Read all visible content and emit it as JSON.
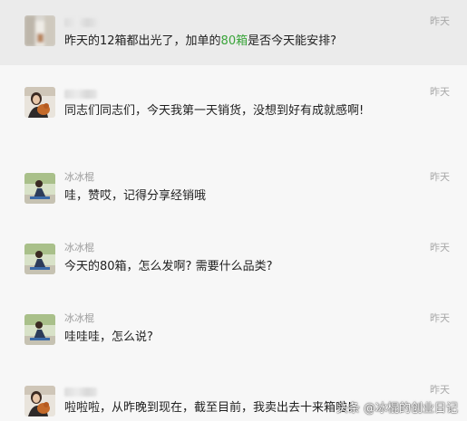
{
  "comments": [
    {
      "name": "",
      "name_blurred": true,
      "time": "昨天",
      "message_before": "昨天的12箱都出光了，加单的",
      "message_highlight": "80箱",
      "message_after": "是否今天能安排?",
      "avatar": "blurred-avatar-icon"
    },
    {
      "name": "",
      "name_blurred": true,
      "time": "昨天",
      "message": "同志们同志们，今天我第一天销货，没想到好有成就感啊!",
      "avatar": "woman-with-dog-avatar-icon"
    },
    {
      "name": "冰冰棍",
      "time": "昨天",
      "message": "哇，赞哎，记得分享经销哦",
      "avatar": "person-outdoors-avatar-icon"
    },
    {
      "name": "冰冰棍",
      "time": "昨天",
      "message": "今天的80箱，怎么发啊? 需要什么品类?",
      "avatar": "person-outdoors-avatar-icon"
    },
    {
      "name": "冰冰棍",
      "time": "昨天",
      "message": "哇哇哇，怎么说?",
      "avatar": "person-outdoors-avatar-icon"
    },
    {
      "name": "",
      "name_blurred": true,
      "time": "昨天",
      "message": "啦啦啦，从昨晚到现在，截至目前，我卖出去十来箱啦!",
      "avatar": "woman-with-dog-avatar-icon"
    }
  ],
  "watermark": "头条 @冰棍的创业日记",
  "colors": {
    "background": "#f7f7f7",
    "highlight_row": "#ebebeb",
    "highlight_text": "#3aa43a",
    "time_text": "#a8a8a8"
  }
}
